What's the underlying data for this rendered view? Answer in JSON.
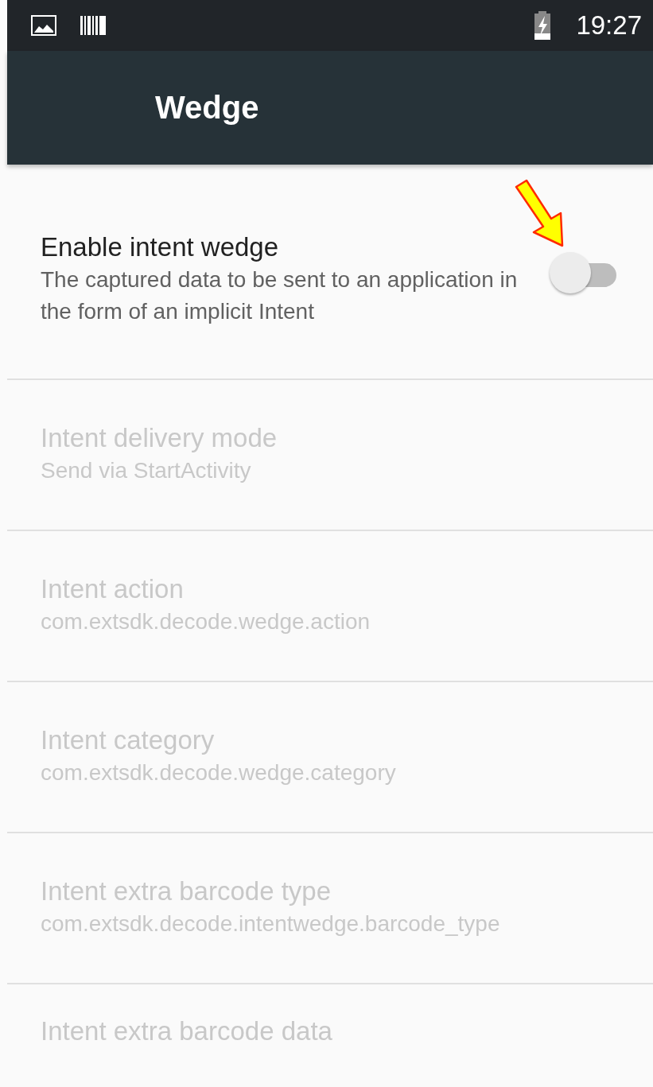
{
  "status_bar": {
    "time": "19:27"
  },
  "app_bar": {
    "title": "Wedge"
  },
  "preferences": [
    {
      "kind": "switch",
      "title": "Enable intent wedge",
      "summary": "The captured data to be sent to an application in the form of an implicit Intent",
      "disabled": false,
      "on": false
    },
    {
      "kind": "text",
      "title": "Intent delivery mode",
      "summary": "Send via StartActivity",
      "disabled": true
    },
    {
      "kind": "text",
      "title": "Intent action",
      "summary": "com.extsdk.decode.wedge.action",
      "disabled": true
    },
    {
      "kind": "text",
      "title": "Intent category",
      "summary": "com.extsdk.decode.wedge.category",
      "disabled": true
    },
    {
      "kind": "text",
      "title": "Intent extra barcode type",
      "summary": "com.extsdk.decode.intentwedge.barcode_type",
      "disabled": true
    },
    {
      "kind": "text",
      "title": "Intent extra barcode data",
      "disabled": true
    }
  ]
}
